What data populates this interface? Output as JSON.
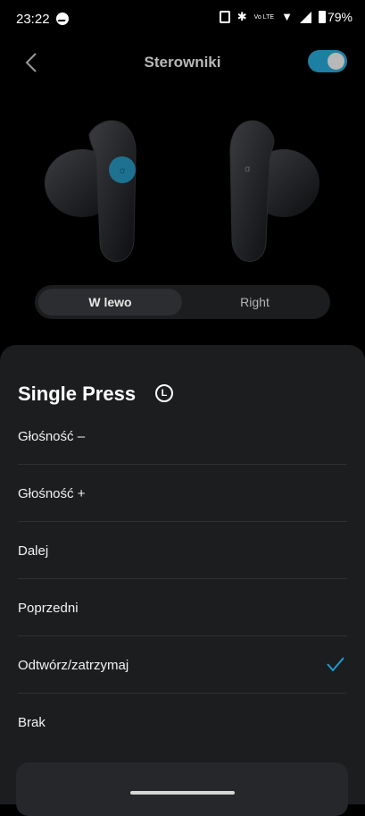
{
  "status_bar": {
    "time": "23:22",
    "network_label": "Vo LTE",
    "battery": "79%"
  },
  "header": {
    "title": "Sterowniki",
    "toggle_on": true,
    "accent_color": "#1d7fa3"
  },
  "side_selector": {
    "left_label": "W lewo",
    "right_label": "Right",
    "selected": "left"
  },
  "action_sheet": {
    "title": "Single Press",
    "side_badge": "L",
    "options": [
      {
        "label": "Głośność –",
        "selected": false
      },
      {
        "label": "Głośność +",
        "selected": false
      },
      {
        "label": "Dalej",
        "selected": false
      },
      {
        "label": "Poprzedni",
        "selected": false
      },
      {
        "label": "Odtwórz/zatrzymaj",
        "selected": true
      },
      {
        "label": "Brak",
        "selected": false
      }
    ]
  },
  "icons": {
    "back": "chevron-left-icon",
    "check": "check-icon",
    "status": [
      "messenger-icon",
      "nfc-icon",
      "bluetooth-icon",
      "volte-icon",
      "wifi-icon",
      "signal-icon",
      "battery-icon"
    ]
  }
}
